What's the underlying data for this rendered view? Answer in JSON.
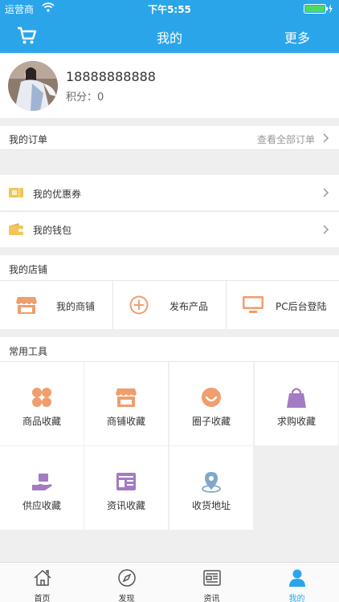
{
  "status_bar": {
    "carrier": "运营商",
    "time": "下午5:55"
  },
  "nav": {
    "title": "我的",
    "more": "更多"
  },
  "profile": {
    "phone": "18888888888",
    "points_label": "积分：",
    "points_value": "0"
  },
  "orders": {
    "title": "我的订单",
    "view_all": "查看全部订单"
  },
  "wallet_section": {
    "coupon": "我的优惠券",
    "wallet": "我的钱包"
  },
  "shop": {
    "title": "我的店铺",
    "items": [
      {
        "label": "我的商铺"
      },
      {
        "label": "发布产品"
      },
      {
        "label": "PC后台登陆"
      }
    ]
  },
  "tools": {
    "title": "常用工具",
    "items": [
      {
        "label": "商品收藏"
      },
      {
        "label": "商铺收藏"
      },
      {
        "label": "圈子收藏"
      },
      {
        "label": "求购收藏"
      },
      {
        "label": "供应收藏"
      },
      {
        "label": "资讯收藏"
      },
      {
        "label": "收货地址"
      }
    ]
  },
  "tabbar": {
    "items": [
      {
        "label": "首页"
      },
      {
        "label": "发现"
      },
      {
        "label": "资讯"
      },
      {
        "label": "我的"
      }
    ],
    "active_index": 3
  },
  "colors": {
    "accent": "#2aa5ea",
    "icon_orange": "#ef9e6d",
    "icon_purple": "#a27bc4",
    "icon_gold": "#f0c55a"
  }
}
